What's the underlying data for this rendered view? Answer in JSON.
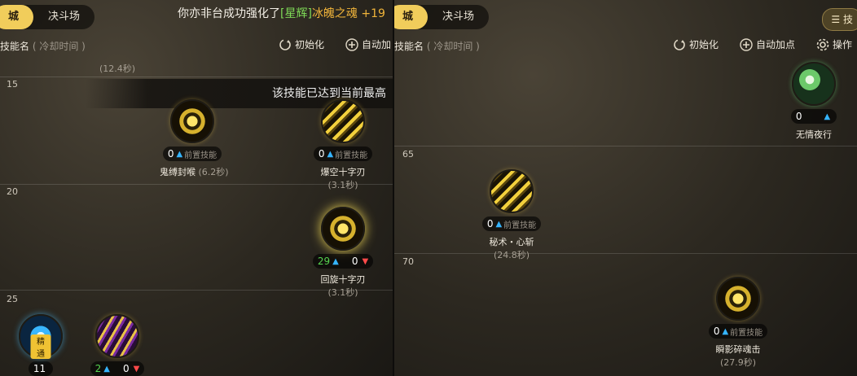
{
  "left": {
    "tabs": [
      "城",
      "决斗场"
    ],
    "active_tab": 0,
    "notice": {
      "prefix": "你亦非台成功强化了",
      "tag": "[星辉]",
      "item": "冰魄之魂 +19"
    },
    "popup": "该技能已达到当前最高",
    "header": {
      "col_label": "技能名",
      "col_sub": "( 冷却时间 )",
      "btn_reset": "初始化",
      "btn_auto": "自动加"
    },
    "partial_top": {
      "cool_left": "(12.4秒)"
    },
    "levels": [
      "15",
      "20",
      "25"
    ],
    "skills": [
      {
        "name": "鬼缚封喉",
        "cool": "(6.2秒)",
        "count": "0",
        "pre": "前置技能"
      },
      {
        "name": "爆空十字刃",
        "cool": "(3.1秒)",
        "count": "0",
        "pre": "前置技能"
      },
      {
        "name": "回旋十字刃",
        "cool": "(3.1秒)",
        "count": "29",
        "count2": "0"
      },
      {
        "badge": "精通",
        "count": "11"
      },
      {
        "count": "2",
        "count2": "0"
      }
    ]
  },
  "right": {
    "tabs": [
      "城",
      "决斗场"
    ],
    "active_tab": 0,
    "top_btn": "技",
    "header": {
      "col_label": "技能名",
      "col_sub": "( 冷却时间 )",
      "btn_reset": "初始化",
      "btn_auto": "自动加点",
      "btn_ops": "操作"
    },
    "levels": [
      "65",
      "70"
    ],
    "skills": [
      {
        "name": "无情夜行",
        "count": "0"
      },
      {
        "name": "秘术・心斩",
        "cool": "(24.8秒)",
        "count": "0",
        "pre": "前置技能"
      },
      {
        "name": "瞬影碎魂击",
        "cool": "(27.9秒)",
        "count": "0",
        "pre": "前置技能"
      }
    ]
  },
  "colors": {
    "tab_active": "#f1cd5b",
    "up_arrow": "#35b4ff",
    "down_arrow": "#ff4a4a",
    "notice_tag": "#7ed957",
    "notice_item": "#f0b43a"
  }
}
